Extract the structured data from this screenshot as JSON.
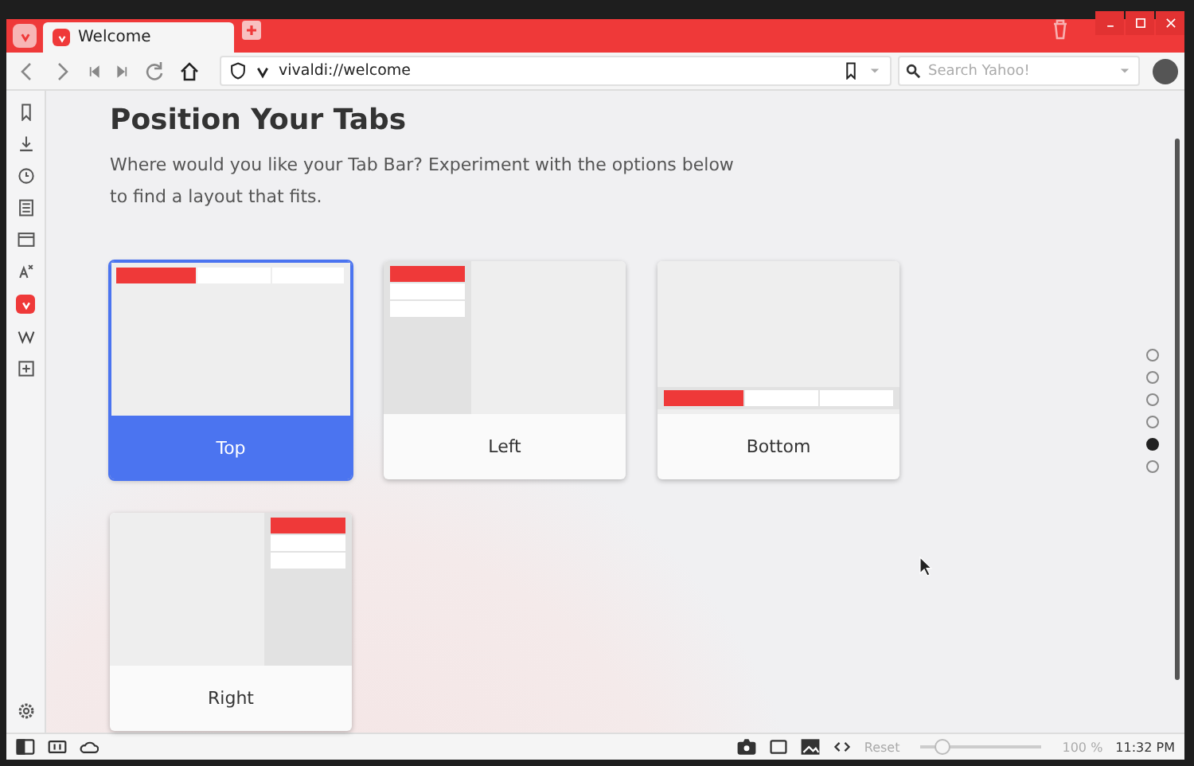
{
  "tab": {
    "title": "Welcome"
  },
  "toolbar": {
    "address": "vivaldi://welcome",
    "search": {
      "placeholder": "Search Yahoo!"
    }
  },
  "page": {
    "title": "Position Your Tabs",
    "description": "Where would you like your Tab Bar? Experiment with the options below to find a layout that fits.",
    "options": [
      {
        "label": "Top",
        "kind": "top",
        "selected": true
      },
      {
        "label": "Left",
        "kind": "left",
        "selected": false
      },
      {
        "label": "Bottom",
        "kind": "bottom",
        "selected": false
      },
      {
        "label": "Right",
        "kind": "right",
        "selected": false
      }
    ],
    "pager": [
      {
        "selected": false
      },
      {
        "selected": false
      },
      {
        "selected": false
      },
      {
        "selected": false
      },
      {
        "selected": true
      },
      {
        "selected": false
      }
    ]
  },
  "status_bar": {
    "reset": "Reset",
    "zoom": {
      "level": 0.18
    },
    "zoom_percent": "100 %",
    "clock": "11:32 PM"
  }
}
